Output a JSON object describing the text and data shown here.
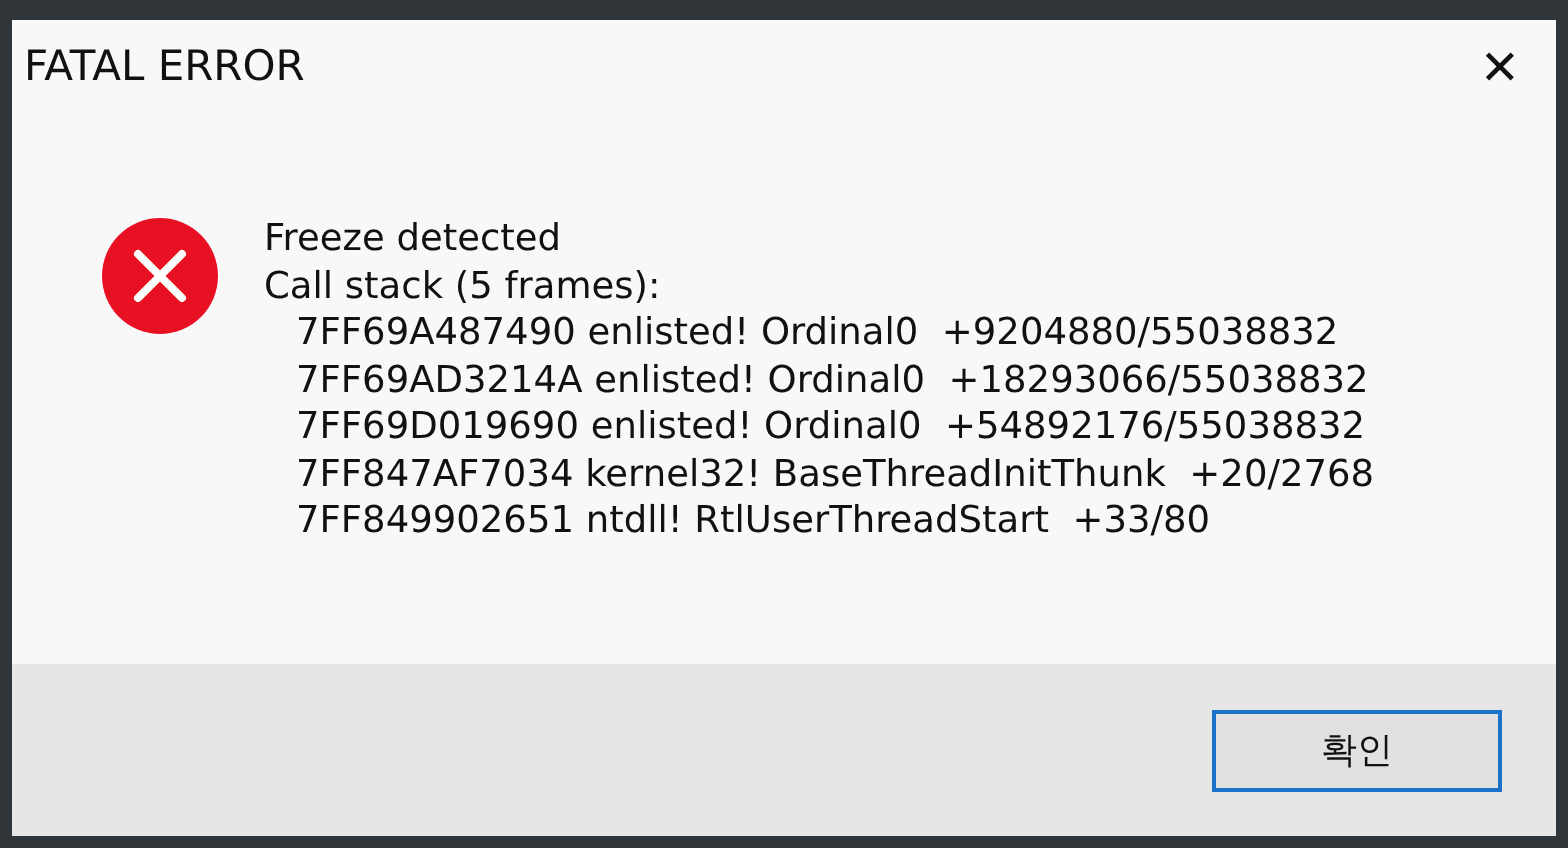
{
  "window": {
    "title": "FATAL ERROR",
    "close": "✕"
  },
  "message": {
    "kind": "error",
    "lines": [
      {
        "text": "Freeze detected",
        "indent": false
      },
      {
        "text": "Call stack (5 frames):",
        "indent": false
      },
      {
        "text": "7FF69A487490 enlisted! Ordinal0  +9204880/55038832",
        "indent": true
      },
      {
        "text": "7FF69AD3214A enlisted! Ordinal0  +18293066/55038832",
        "indent": true
      },
      {
        "text": "7FF69D019690 enlisted! Ordinal0  +54892176/55038832",
        "indent": true
      },
      {
        "text": "7FF847AF7034 kernel32! BaseThreadInitThunk  +20/2768",
        "indent": true
      },
      {
        "text": "7FF849902651 ntdll! RtlUserThreadStart  +33/80",
        "indent": true
      }
    ]
  },
  "buttons": [
    {
      "label": "확인",
      "focused": true
    }
  ]
}
